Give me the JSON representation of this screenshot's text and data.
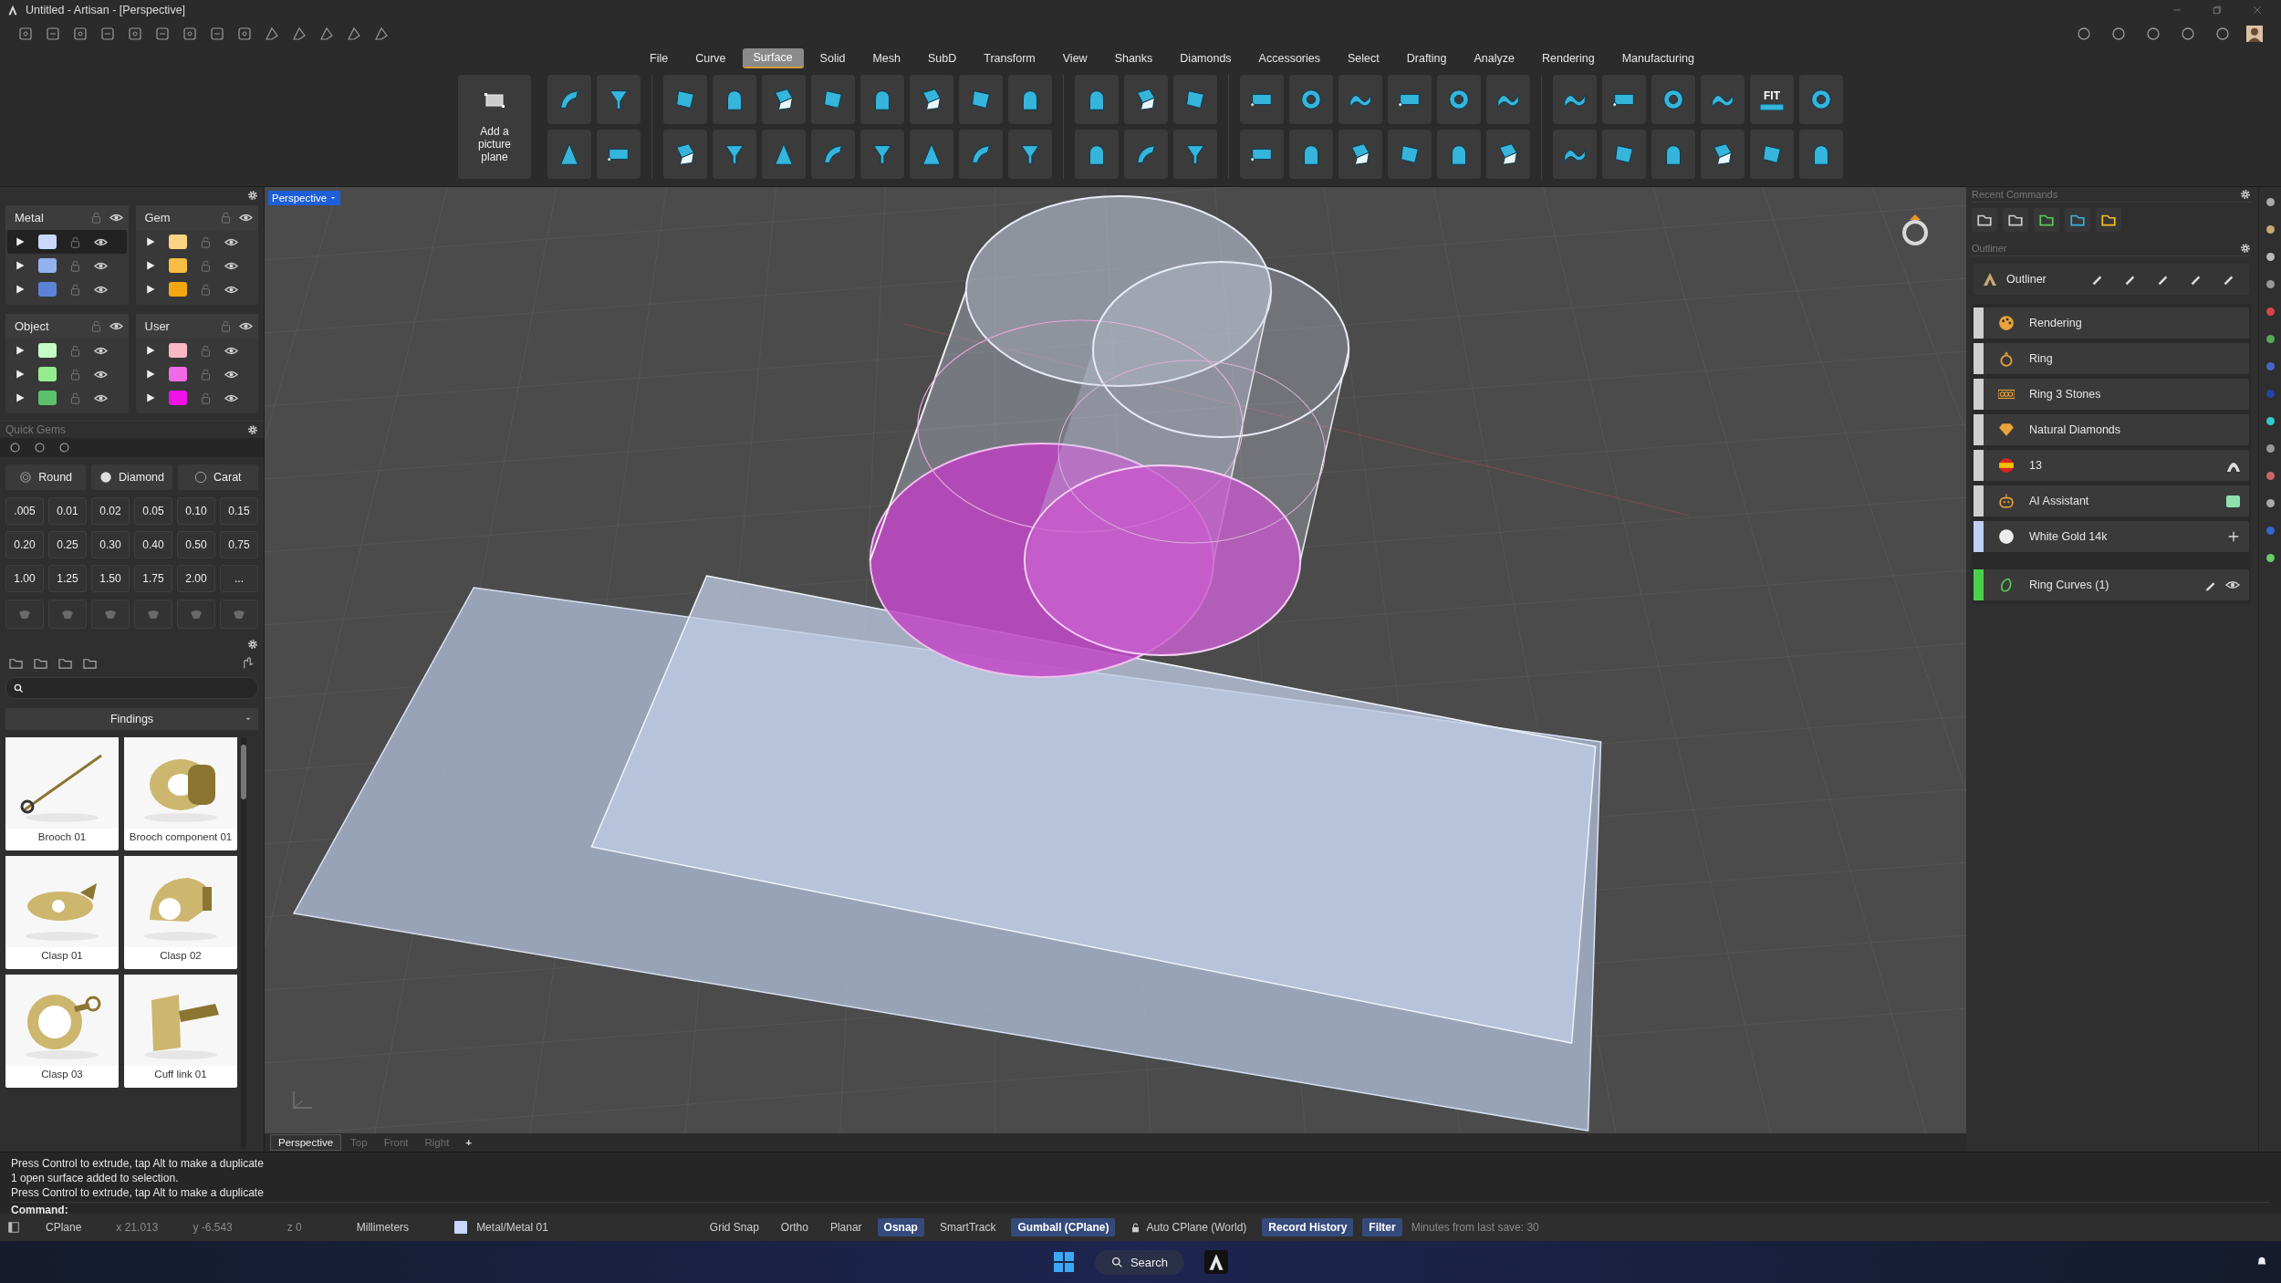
{
  "window": {
    "title": "Untitled - Artisan - [Perspective]"
  },
  "menu": [
    {
      "label": "File",
      "selected": false
    },
    {
      "label": "Curve",
      "selected": false
    },
    {
      "label": "Surface",
      "selected": true
    },
    {
      "label": "Solid",
      "selected": false
    },
    {
      "label": "Mesh",
      "selected": false
    },
    {
      "label": "SubD",
      "selected": false
    },
    {
      "label": "Transform",
      "selected": false
    },
    {
      "label": "View",
      "selected": false
    },
    {
      "label": "Shanks",
      "selected": false
    },
    {
      "label": "Diamonds",
      "selected": false
    },
    {
      "label": "Accessories",
      "selected": false
    },
    {
      "label": "Select",
      "selected": false
    },
    {
      "label": "Drafting",
      "selected": false
    },
    {
      "label": "Analyze",
      "selected": false
    },
    {
      "label": "Rendering",
      "selected": false
    },
    {
      "label": "Manufacturing",
      "selected": false
    }
  ],
  "ribbon": {
    "picture_plane_label": "Add a picture plane",
    "fit_label": "FIT"
  },
  "layers": {
    "groups": [
      {
        "name": "Metal",
        "rows": [
          {
            "color": "#c8d7fb",
            "selected": true
          },
          {
            "color": "#93b2ef",
            "selected": false
          },
          {
            "color": "#5b82d6",
            "selected": false
          }
        ]
      },
      {
        "name": "Gem",
        "rows": [
          {
            "color": "#fbd183",
            "selected": false
          },
          {
            "color": "#f8bd45",
            "selected": false
          },
          {
            "color": "#f3a712",
            "selected": false
          }
        ]
      },
      {
        "name": "Object",
        "rows": [
          {
            "color": "#c6fbc6",
            "selected": false
          },
          {
            "color": "#94ec8f",
            "selected": false
          },
          {
            "color": "#5cc16a",
            "selected": false
          }
        ]
      },
      {
        "name": "User",
        "rows": [
          {
            "color": "#f9b8c6",
            "selected": false
          },
          {
            "color": "#f06ae6",
            "selected": false
          },
          {
            "color": "#f010e8",
            "selected": false
          }
        ]
      }
    ]
  },
  "quick_gems": {
    "title": "Quick Gems",
    "shape": "Round",
    "material": "Diamond",
    "unit": "Carat",
    "sizes": [
      ".005",
      "0.01",
      "0.02",
      "0.05",
      "0.10",
      "0.15",
      "0.20",
      "0.25",
      "0.30",
      "0.40",
      "0.50",
      "0.75",
      "1.00",
      "1.25",
      "1.50",
      "1.75",
      "2.00",
      "..."
    ]
  },
  "library": {
    "category": "Findings",
    "items": [
      {
        "label": "Brooch 01"
      },
      {
        "label": "Brooch component 01"
      },
      {
        "label": "Clasp 01"
      },
      {
        "label": "Clasp 02"
      },
      {
        "label": "Clasp 03"
      },
      {
        "label": "Cuff link 01"
      }
    ]
  },
  "viewport": {
    "label": "Perspective",
    "view_tabs": [
      {
        "label": "Perspective",
        "selected": true
      },
      {
        "label": "Top",
        "selected": false
      },
      {
        "label": "Front",
        "selected": false
      },
      {
        "label": "Right",
        "selected": false
      }
    ],
    "add_tab": "+"
  },
  "recent_commands": {
    "title": "Recent Commands"
  },
  "outliner": {
    "title": "Outliner",
    "header": "Outliner",
    "items": [
      {
        "label": "Rendering",
        "color": "#cfcfcf",
        "kind": "plain"
      },
      {
        "label": "Ring",
        "color": "#cfcfcf",
        "kind": "plain"
      },
      {
        "label": "Ring 3 Stones",
        "color": "#cfcfcf",
        "kind": "plain"
      },
      {
        "label": "Natural Diamonds",
        "color": "#cfcfcf",
        "kind": "plain"
      },
      {
        "label": "13",
        "color": "#cfcfcf",
        "kind": "profile"
      },
      {
        "label": "AI Assistant",
        "color": "#cfcfcf",
        "kind": "swatch"
      },
      {
        "label": "White Gold 14k",
        "color": "#bcd0f5",
        "kind": "add"
      },
      {
        "label": "Ring Curves (1)",
        "color": "#4cd04c",
        "kind": "layer"
      }
    ]
  },
  "command": {
    "history": [
      "Press Control to extrude, tap Alt to make a duplicate",
      "1 open surface added to selection.",
      "Press Control to extrude, tap Alt to make a duplicate"
    ],
    "prompt": "Command:"
  },
  "status_bar": {
    "cplane": "CPlane",
    "x": "x 21.013",
    "y": "y -6.543",
    "z": "z 0",
    "units": "Millimeters",
    "layer": "Metal/Metal 01",
    "toggles": [
      {
        "label": "Grid Snap",
        "on": false,
        "kind": "plain"
      },
      {
        "label": "Ortho",
        "on": false,
        "kind": "plain"
      },
      {
        "label": "Planar",
        "on": false,
        "kind": "plain"
      },
      {
        "label": "Osnap",
        "on": true,
        "kind": "plain"
      },
      {
        "label": "SmartTrack",
        "on": false,
        "kind": "plain"
      },
      {
        "label": "Gumball (CPlane)",
        "on": true,
        "kind": "plain"
      },
      {
        "label": "Auto CPlane (World)",
        "on": false,
        "kind": "lock"
      },
      {
        "label": "Record History",
        "on": true,
        "kind": "plain"
      },
      {
        "label": "Filter",
        "on": true,
        "kind": "plain"
      }
    ],
    "save_info": "Minutes from last save: 30"
  },
  "taskbar": {
    "search": "Search"
  }
}
